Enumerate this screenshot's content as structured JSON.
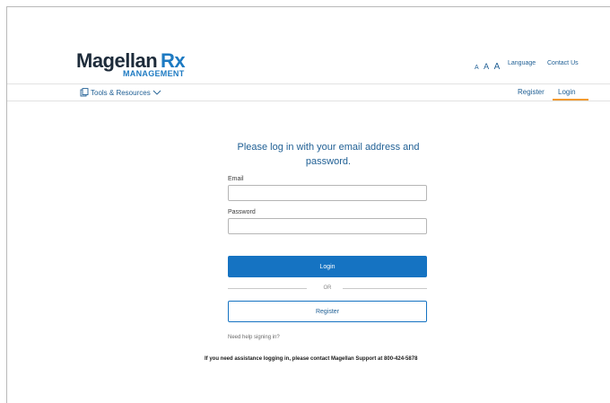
{
  "brand": {
    "name": "Magellan",
    "rx": "Rx",
    "sub": "MANAGEMENT"
  },
  "utility": {
    "text_size": [
      "A",
      "A",
      "A"
    ],
    "language": "Language",
    "contact": "Contact Us"
  },
  "nav": {
    "tools": "Tools & Resources",
    "register": "Register",
    "login": "Login"
  },
  "form": {
    "heading": "Please log in with your email address and password.",
    "email_label": "Email",
    "email_value": "",
    "password_label": "Password",
    "password_value": "",
    "login_button": "Login",
    "or": "OR",
    "register_button": "Register",
    "help_link": "Need help signing in?",
    "assistance": "If you need assistance logging in, please contact Magellan Support at 800-424-5878"
  },
  "colors": {
    "accent": "#1573c2",
    "brand_dark": "#1d2b3a",
    "active_tab": "#f29a2e"
  }
}
